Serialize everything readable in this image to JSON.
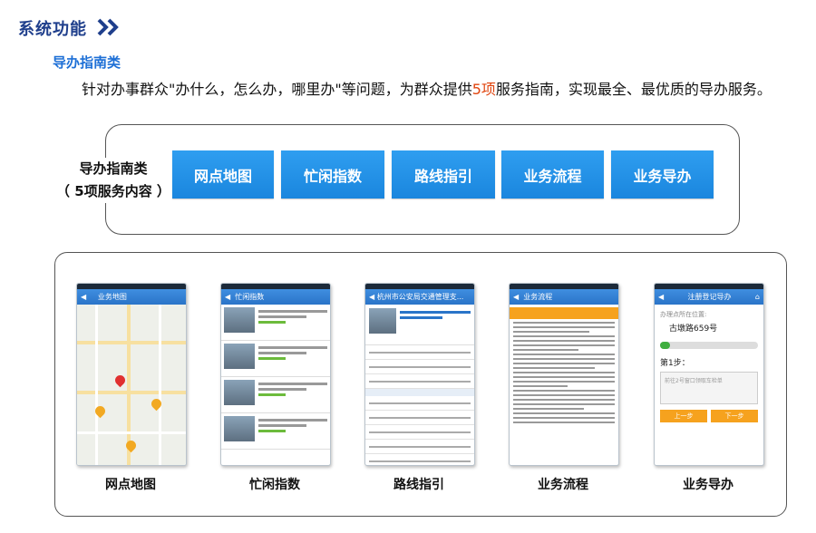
{
  "section_title": "系统功能",
  "subheading": "导办指南类",
  "paragraph": {
    "before": "针对办事群众\"办什么，怎么办，哪里办\"等问题，为群众提供",
    "highlight": "5项",
    "after": "服务指南，实现最全、最优质的导办服务。"
  },
  "category": {
    "line1": "导办指南类",
    "line2": "（ 5项服务内容 ）"
  },
  "services": [
    "网点地图",
    "忙闲指数",
    "路线指引",
    "业务流程",
    "业务导办"
  ],
  "screens": {
    "map": {
      "title": "业务地图"
    },
    "busy": {
      "title": "忙闲指数"
    },
    "route": {
      "title": "杭州市公安局交通管理支..."
    },
    "flow": {
      "title": "业务流程"
    },
    "guide": {
      "title": "注册登记导办",
      "location_label": "办理点所在位置:",
      "location": "古墩路659号",
      "step_label": "第1步：",
      "step_text": "前往2号窗口领取车检单",
      "prev": "上一步",
      "next": "下一步"
    }
  },
  "captions": [
    "网点地图",
    "忙闲指数",
    "路线指引",
    "业务流程",
    "业务导办"
  ],
  "colors": {
    "title": "#1f3f8c",
    "subheading": "#1d6fd6",
    "highlight": "#e0430c",
    "button": "#1a86de"
  }
}
